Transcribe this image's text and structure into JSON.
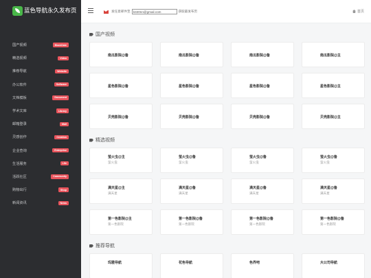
{
  "brand": {
    "title": "蓝色导航永久发布页"
  },
  "sidebar": {
    "items": [
      {
        "label": "国产视频",
        "badge": "BlackDate"
      },
      {
        "label": "精选视频",
        "badge": "Video"
      },
      {
        "label": "推荐导航",
        "badge": "Website"
      },
      {
        "label": "办公软件",
        "badge": "Software"
      },
      {
        "label": "文档模板",
        "badge": "Document"
      },
      {
        "label": "学术文库",
        "badge": "Library"
      },
      {
        "label": "邮箱登录",
        "badge": "Mail"
      },
      {
        "label": "灵感创作",
        "badge": "Creation"
      },
      {
        "label": "企业查询",
        "badge": "Enterprise"
      },
      {
        "label": "生活服务",
        "badge": "Life"
      },
      {
        "label": "活跃社区",
        "badge": "Community"
      },
      {
        "label": "购物出行",
        "badge": "Shop"
      },
      {
        "label": "新闻资讯",
        "badge": "News"
      }
    ]
  },
  "topbar": {
    "notice_prefix": "发任意邮件至",
    "email": "b320nn@gmail.com",
    "notice_suffix": "获取最发布页",
    "home": "首页"
  },
  "sections": {
    "s1": {
      "title": "国产视频",
      "rows": [
        [
          "南瓜影院@备",
          "南瓜影院@备",
          "南瓜影院@备",
          "南瓜影院@主"
        ],
        [
          "星色影院@备",
          "星色影院@备",
          "星色影院@备",
          "星色影院@主"
        ],
        [
          "贝壳影院@备",
          "贝壳影院@备",
          "贝壳影院@备",
          "贝壳影院@主"
        ]
      ]
    },
    "s2": {
      "title": "精选视频",
      "rows": [
        [
          {
            "name": "萤火虫@主",
            "desc": "萤火虫"
          },
          {
            "name": "萤火虫@备",
            "desc": "萤火虫"
          },
          {
            "name": "萤火虫@备",
            "desc": "萤火虫"
          },
          {
            "name": "萤火虫@备",
            "desc": "萤火虫"
          }
        ],
        [
          {
            "name": "满天星@主",
            "desc": "满天星"
          },
          {
            "name": "满天星@备",
            "desc": "满天星"
          },
          {
            "name": "满天星@备",
            "desc": "满天星"
          },
          {
            "name": "满天星@备",
            "desc": "满天星"
          }
        ],
        [
          {
            "name": "第一色影院@主",
            "desc": "第一色影院"
          },
          {
            "name": "第一色影院@备",
            "desc": "第一色影院"
          },
          {
            "name": "第一色影院@备",
            "desc": "第一色影院"
          },
          {
            "name": "第一色影院@备",
            "desc": "第一色影院"
          }
        ]
      ]
    },
    "s3": {
      "title": "推荐导航",
      "row": [
        "玛雅导航",
        "花色导航",
        "色界吧",
        "大公司导航"
      ]
    }
  },
  "colors": {
    "sidebar_bg": "#2c2d30",
    "badge": "#e9545c",
    "brand_leaf": "#49b749",
    "mail_icon": "#d9443d"
  }
}
